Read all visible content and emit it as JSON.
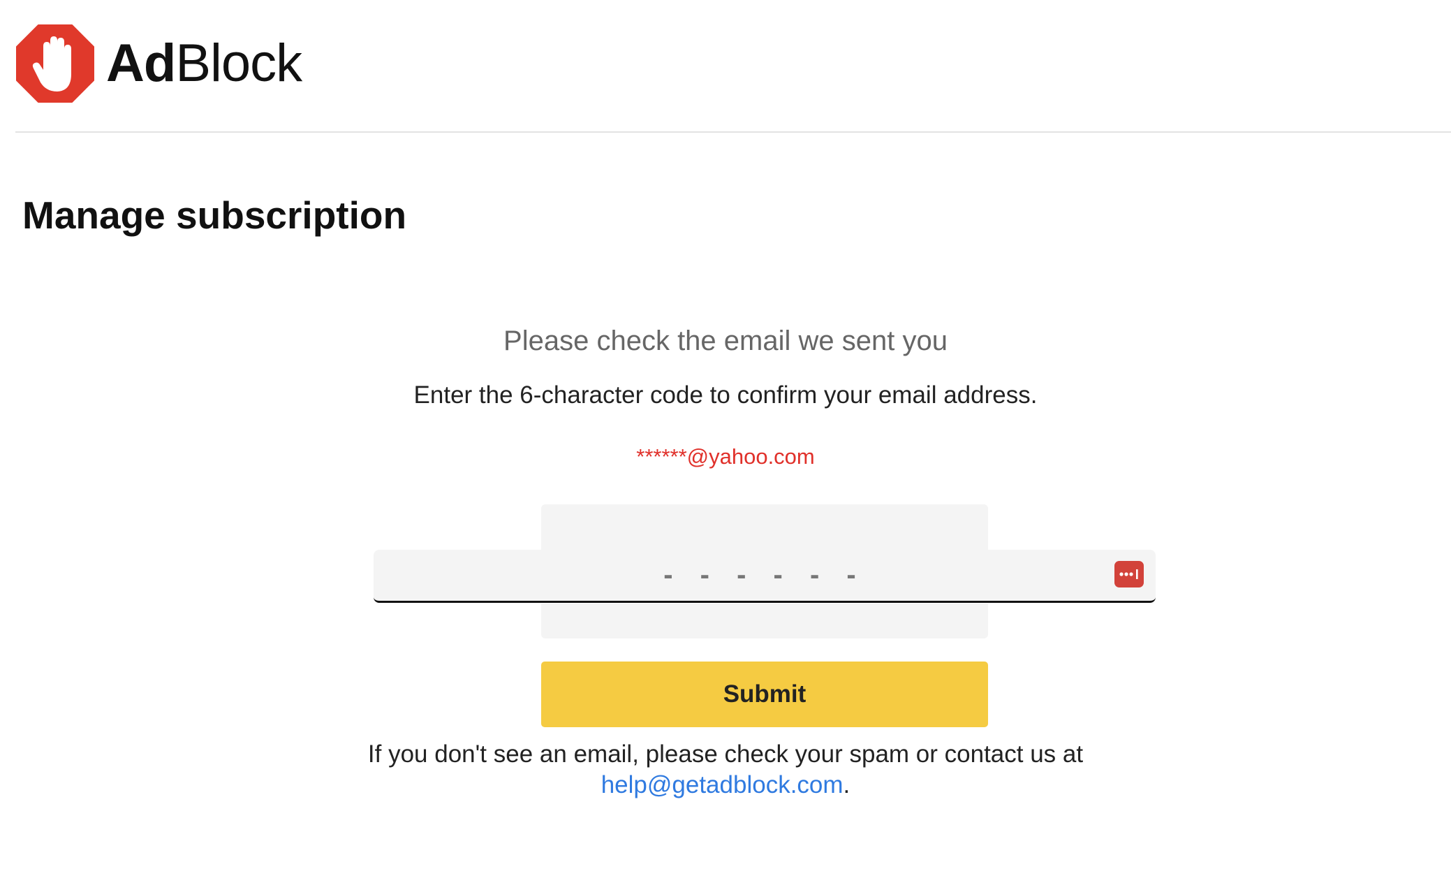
{
  "brand": {
    "name_part1": "Ad",
    "name_part2": "Block",
    "logo_icon": "stop-hand-icon",
    "logo_color": "#e0392b"
  },
  "page": {
    "title": "Manage subscription"
  },
  "verification": {
    "subtitle": "Please check the email we sent you",
    "instructions": "Enter the 6-character code to confirm your email address.",
    "masked_email": "******@yahoo.com",
    "code_placeholder": "- - - - - -",
    "code_value": "",
    "password_manager_icon": "password-dots-icon"
  },
  "actions": {
    "submit_label": "Submit",
    "submit_color": "#f5cb42"
  },
  "footer": {
    "note_text": "If you don't see an email, please check your spam or contact us at",
    "contact_email": "help@getadblock.com",
    "trailing_period": ".",
    "link_color": "#2f7ae0"
  },
  "colors": {
    "email_highlight": "#e0302a",
    "input_background": "#f4f4f4"
  }
}
